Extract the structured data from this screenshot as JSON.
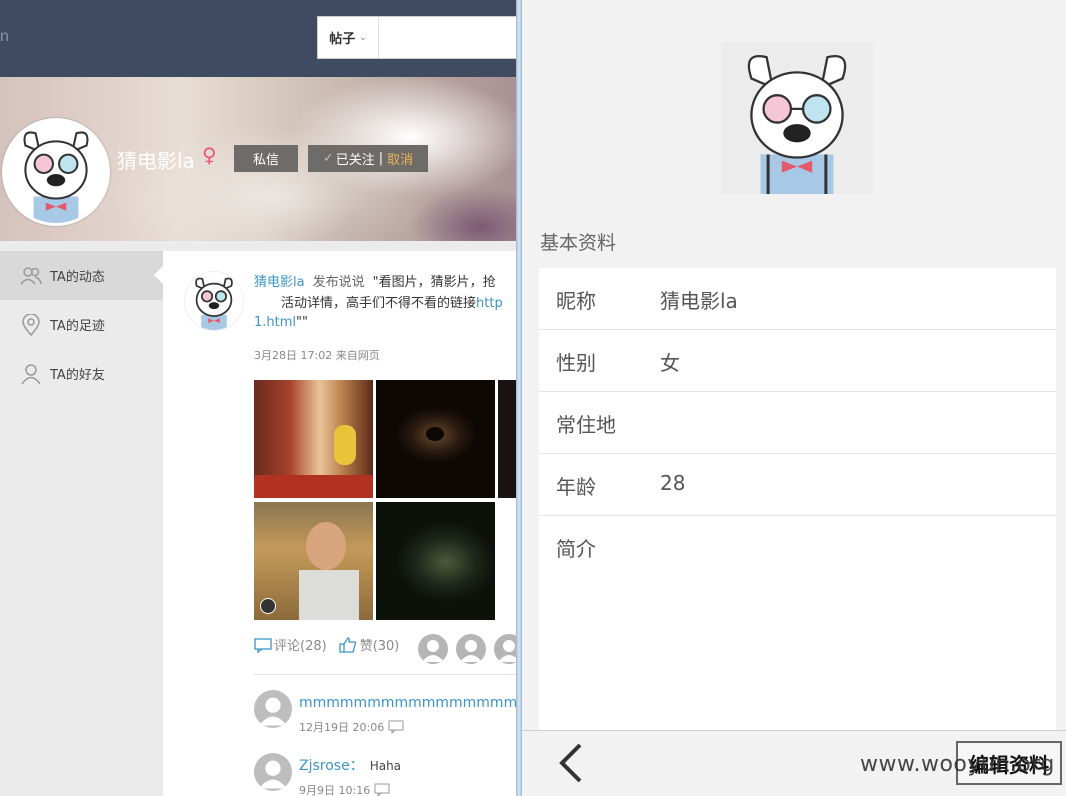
{
  "left": {
    "topbar": {
      "logo_fragment": "n",
      "search_type": "帖子"
    },
    "profile": {
      "name": "猜电影la",
      "gender_symbol": "♀",
      "pm_label": "私信",
      "follow_label": "已关注",
      "follow_sep": "|",
      "cancel_label": "取消"
    },
    "sidebar": {
      "items": [
        {
          "label": "TA的动态",
          "icon": "people-icon"
        },
        {
          "label": "TA的足迹",
          "icon": "location-pin-icon"
        },
        {
          "label": "TA的好友",
          "icon": "person-icon"
        }
      ]
    },
    "post": {
      "author": "猜电影la",
      "verb": "发布说说",
      "text_line1": "\"看图片，猜影片，抢",
      "text_line2": "活动详情，高手们不得不看的链接",
      "link_prefix": "http",
      "link_suffix": "1.html",
      "close_quotes": "\"\"",
      "time": "3月28日 17:02 来自网页",
      "comments_label": "评论(28)",
      "likes_label": "赞(30)"
    },
    "comments": [
      {
        "name": "mmmmmmmmmmmmmmmm：",
        "text": "",
        "time": "12月19日 20:06"
      },
      {
        "name": "Zjsrose：",
        "text": "Haha",
        "time": "9月9日 10:16"
      }
    ]
  },
  "right": {
    "section_title": "基本资料",
    "fields": [
      {
        "key": "昵称",
        "value": "猜电影la"
      },
      {
        "key": "性别",
        "value": "女"
      },
      {
        "key": "常住地",
        "value": ""
      },
      {
        "key": "年龄",
        "value": "28"
      },
      {
        "key": "简介",
        "value": ""
      }
    ],
    "back_icon": "chevron-left-icon",
    "edit_label": "编辑资料"
  },
  "watermark": "www.wooyun.org",
  "colors": {
    "link": "#3c94c8",
    "topbar": "#3e4b60",
    "female": "#e9547b",
    "cancel": "#e8b45a"
  }
}
